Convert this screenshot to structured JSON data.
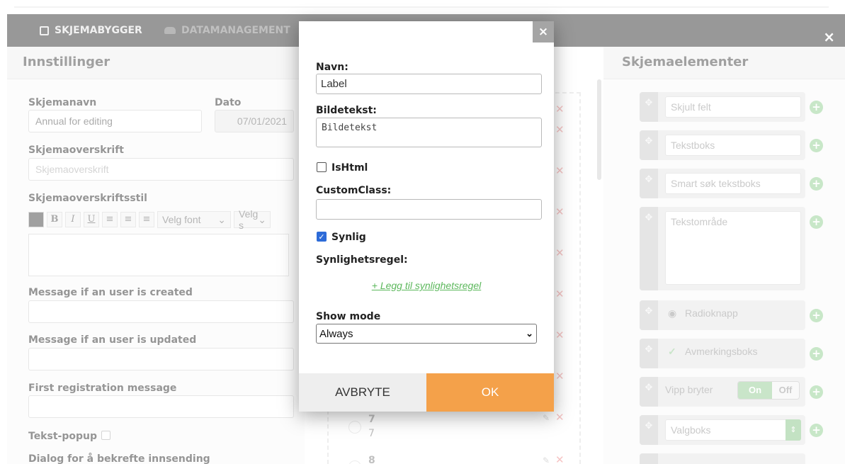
{
  "navbar": {
    "tab_builder": "SKJEMABYGGER",
    "tab_data": "DATAMANAGEMENT",
    "close": "×"
  },
  "left": {
    "title": "Innstillinger",
    "form_name_label": "Skjemanavn",
    "form_name_value": "Annual for editing",
    "date_label": "Dato",
    "date_value": "07/01/2021",
    "heading_label": "Skjemaoverskrift",
    "heading_placeholder": "Skjemaoverskrift",
    "heading_style_label": "Skjemaoverskriftsstil",
    "toolbar": {
      "bold": "B",
      "italic": "I",
      "underline": "U",
      "font_select": "Velg font",
      "size_select": "Velg s"
    },
    "msg_created_label": "Message if an user is created",
    "msg_updated_label": "Message if an user is updated",
    "first_reg_label": "First registration message",
    "text_popup_label": "Tekst-popup",
    "confirm_dialog_label": "Dialog for å bekrefte innsending"
  },
  "middle": {
    "options": [
      {
        "label": "7",
        "value": "7"
      },
      {
        "label": "8",
        "value": ""
      }
    ]
  },
  "right": {
    "title": "Skjemaelementer",
    "components": {
      "hidden": "Skjult felt",
      "textbox": "Tekstboks",
      "smart_search": "Smart søk tekstboks",
      "textarea": "Tekstområde",
      "radio": "Radioknapp",
      "checkbox": "Avmerkingsboks",
      "toggle": "Vipp bryter",
      "toggle_on": "On",
      "toggle_off": "Off",
      "select": "Valgboks"
    }
  },
  "modal": {
    "close": "×",
    "name_label": "Navn:",
    "name_value": "Label",
    "caption_label": "Bildetekst:",
    "caption_value": "Bildetekst",
    "ishtml_label": "IsHtml",
    "ishtml_checked": false,
    "customclass_label": "CustomClass:",
    "customclass_value": "",
    "visible_label": "Synlig",
    "visible_checked": true,
    "visibility_rule_label": "Synlighetsregel:",
    "add_rule_link": "+ Legg til synlighetsregel",
    "show_mode_label": "Show mode",
    "show_mode_value": "Always",
    "cancel_label": "AVBRYTE",
    "ok_label": "OK"
  },
  "colors": {
    "ok_button": "#f4a14a",
    "link_green": "#5cb85c",
    "navbar": "#595959"
  }
}
